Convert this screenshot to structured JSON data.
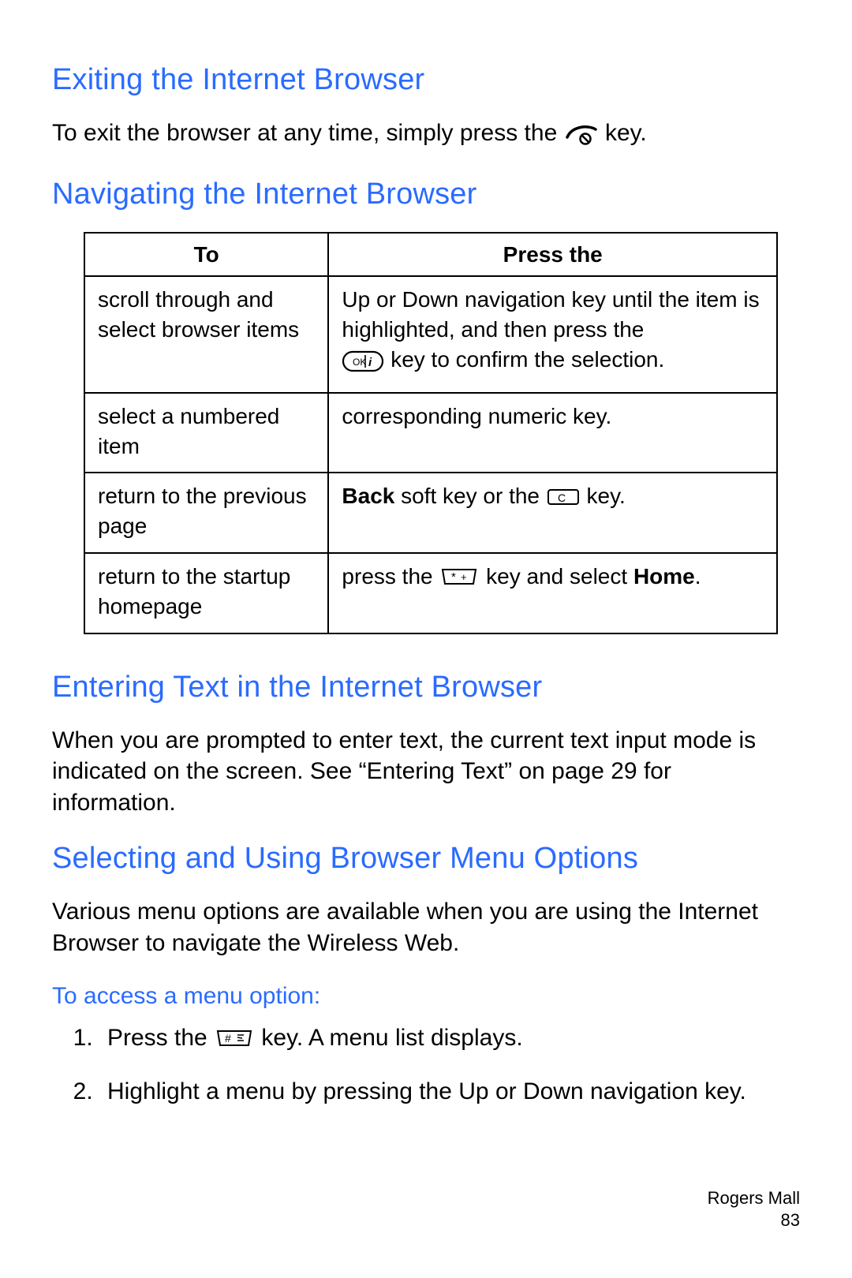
{
  "section_exit": {
    "heading": "Exiting the Internet Browser",
    "text_before_icon": "To exit the browser at any time, simply press the ",
    "text_after_icon": " key."
  },
  "section_nav": {
    "heading": "Navigating the Internet Browser",
    "table": {
      "header_to": "To",
      "header_press": "Press the",
      "rows": {
        "r1": {
          "to": "scroll through and select browser items",
          "press_line1": "Up or Down navigation key until the item is highlighted, and then press the",
          "press_after_icon": " key to confirm the selection."
        },
        "r2": {
          "to": "select a numbered item",
          "press": "corresponding numeric key."
        },
        "r3": {
          "to": "return to the previous page",
          "press_back": "Back",
          "press_mid": " soft key or the ",
          "press_after_icon": " key."
        },
        "r4": {
          "to": "return to the startup homepage",
          "press_pre": "press the ",
          "press_mid": " key and select ",
          "press_home": "Home",
          "press_end": "."
        }
      }
    }
  },
  "section_text": {
    "heading": "Entering Text in the Internet Browser",
    "body": "When you are prompted to enter text, the current text input mode is indicated on the screen. See “Entering Text” on page 29 for information."
  },
  "section_menu": {
    "heading": "Selecting and Using Browser Menu Options",
    "body": "Various menu options are available when you are using the Internet Browser to navigate the Wireless Web.",
    "subhead": "To access a menu option:",
    "steps": {
      "s1_pre": "Press the ",
      "s1_post": " key. A menu list displays.",
      "s2": "Highlight a menu by pressing the Up or Down navigation key."
    }
  },
  "footer": {
    "title": "Rogers Mall",
    "page": "83"
  }
}
